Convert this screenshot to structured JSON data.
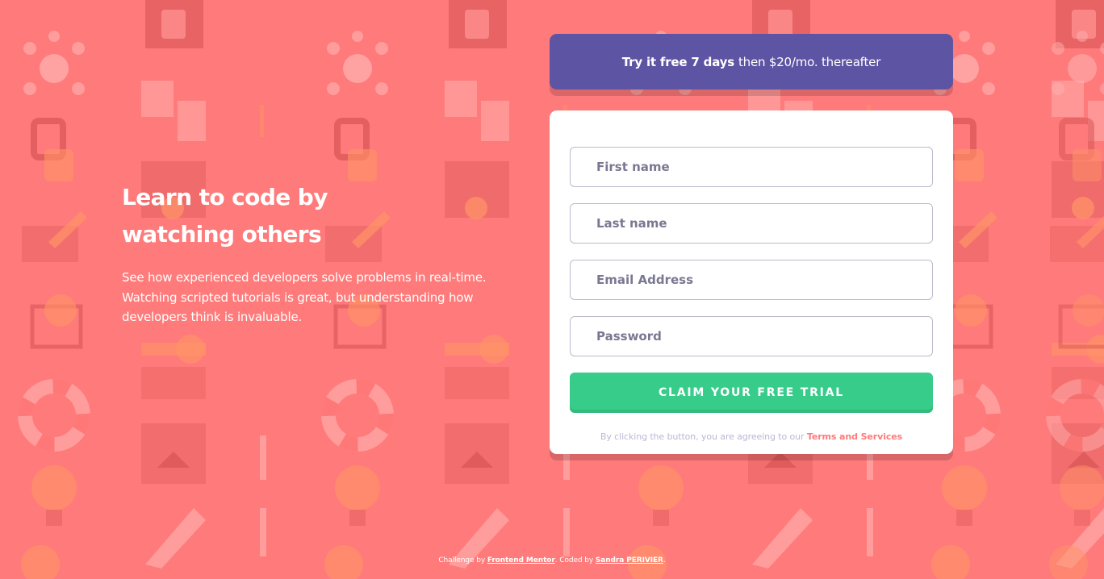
{
  "colors": {
    "background": "#ff7a7a",
    "offer_banner": "#5e54a4",
    "cta_button": "#38cc8b",
    "card": "#ffffff",
    "terms_link": "#ff7a7a"
  },
  "background_icons": [
    "gift-icon",
    "network-icon",
    "puzzle-icon",
    "lock-icon",
    "folder-gear-icon",
    "pencil-icon",
    "browser-search-icon",
    "cart-icon",
    "key-icon",
    "lifebuoy-icon",
    "house-browser-icon",
    "lightbulb-icon",
    "rocket-icon",
    "coin-icon"
  ],
  "intro": {
    "heading": "Learn to code by watching others",
    "description": "See how experienced developers solve problems in real-time. Watching scripted tutorials is great, but understanding how developers think is invaluable."
  },
  "offer": {
    "bold": "Try it free 7 days",
    "rest": "then $20/mo. thereafter"
  },
  "form": {
    "first_name_placeholder": "First name",
    "last_name_placeholder": "Last name",
    "email_placeholder": "Email Address",
    "password_placeholder": "Password",
    "submit_label": "Claim your free trial",
    "terms_prefix": "By clicking the button, you are agreeing to our",
    "terms_link": "Terms and Services"
  },
  "footer": {
    "challenge_prefix": "Challenge by",
    "challenge_link": "Frontend Mentor",
    "coded_prefix": ". Coded by",
    "author_link": "Sandra PERIVIER",
    "suffix": "."
  }
}
